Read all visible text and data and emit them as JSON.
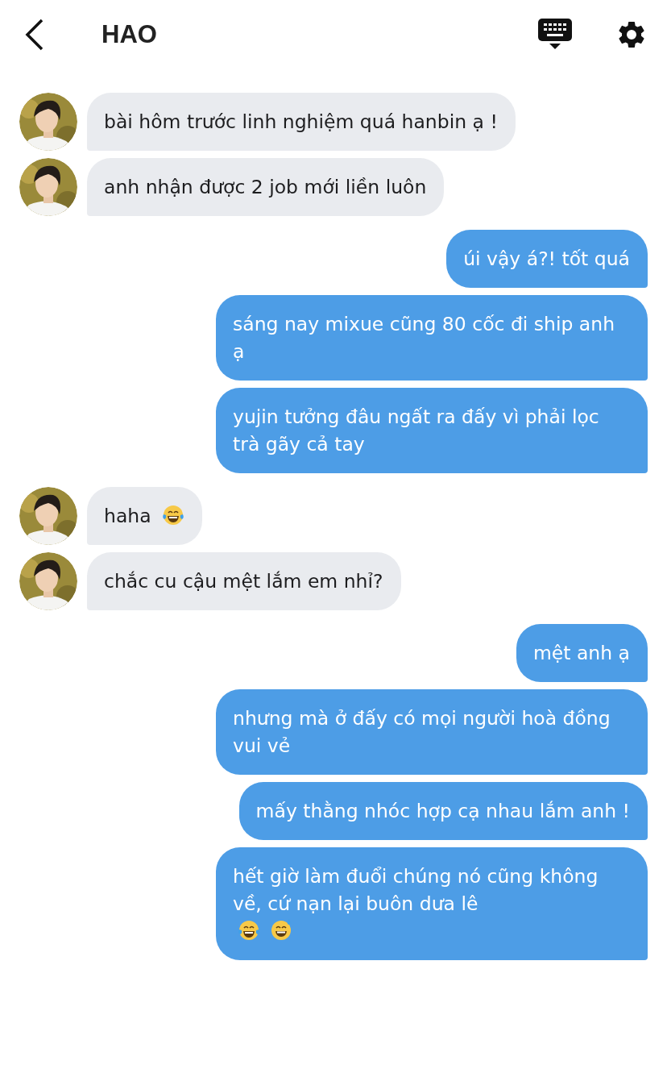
{
  "header": {
    "title": "HAO"
  },
  "messages": [
    {
      "kind": "incoming",
      "text": "bài hôm trước linh nghiệm quá hanbin ạ !"
    },
    {
      "kind": "incoming",
      "text": "anh nhận được 2 job mới liền luôn"
    },
    {
      "kind": "outgoing",
      "text": "úi vậy á?! tốt quá"
    },
    {
      "kind": "outgoing",
      "text": "sáng nay mixue cũng 80 cốc đi ship anh ạ"
    },
    {
      "kind": "outgoing",
      "text": "yujin tưởng đâu ngất ra đấy vì phải lọc trà gãy cả tay"
    },
    {
      "kind": "incoming",
      "text": "haha",
      "emoji": [
        {
          "kind": "tears-of-joy"
        }
      ]
    },
    {
      "kind": "incoming",
      "text": "chắc cu cậu mệt lắm em nhỉ?"
    },
    {
      "kind": "outgoing",
      "text": "mệt anh ạ"
    },
    {
      "kind": "outgoing",
      "text": "nhưng mà ở đấy có mọi người hoà đồng vui vẻ"
    },
    {
      "kind": "outgoing",
      "text": "mấy thằng nhóc hợp cạ nhau lắm anh !"
    },
    {
      "kind": "outgoing",
      "text": "hết giờ làm đuổi chúng nó cũng không về, cứ nạn lại buôn dưa lê",
      "emoji": [
        {
          "kind": "tears-of-joy"
        },
        {
          "kind": "sweat-smile"
        }
      ]
    }
  ]
}
